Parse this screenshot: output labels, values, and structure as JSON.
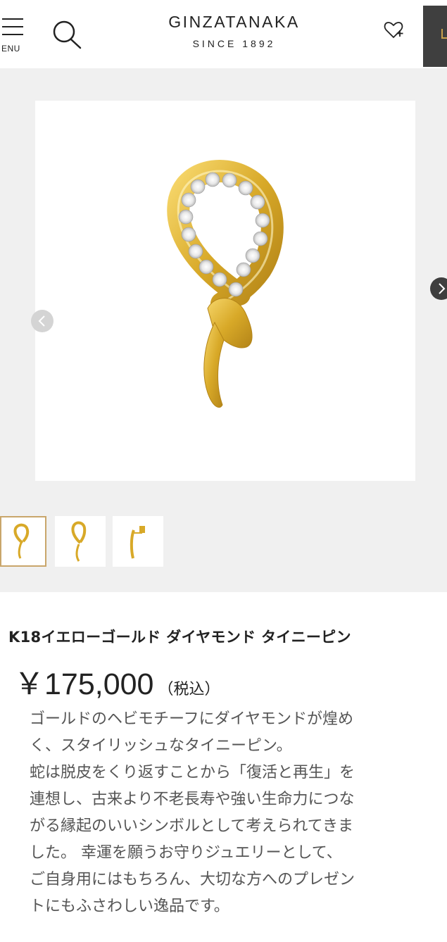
{
  "header": {
    "menu_label": "ENU",
    "logo_main": "GINZATANAKA",
    "logo_sub": "SINCE 1892"
  },
  "gallery": {
    "thumbnail_count": 3,
    "active_thumbnail": 1
  },
  "product": {
    "title": "K18イエローゴールド ダイヤモンド タイニーピン",
    "price": "￥175,000",
    "tax_label": "（税込）",
    "description_lines": [
      "ゴールドのヘビモチーフにダイヤモンドが煌め",
      "く、スタイリッシュなタイニーピン。",
      "蛇は脱皮をくり返すことから「復活と再生」を",
      "連想し、古来より不老長寿や強い生命力につな",
      "がる縁起のいいシンボルとして考えられてきま",
      "した。 幸運を願うお守りジュエリーとして、",
      "ご自身用にはもちろん、大切な方へのプレゼン",
      "トにもふさわしい逸品です。"
    ]
  },
  "colors": {
    "gold": "#c9a04b",
    "gold_light": "#e8c25a",
    "gallery_bg": "#f0f0f0",
    "cart_bg": "#3f3f3f"
  }
}
